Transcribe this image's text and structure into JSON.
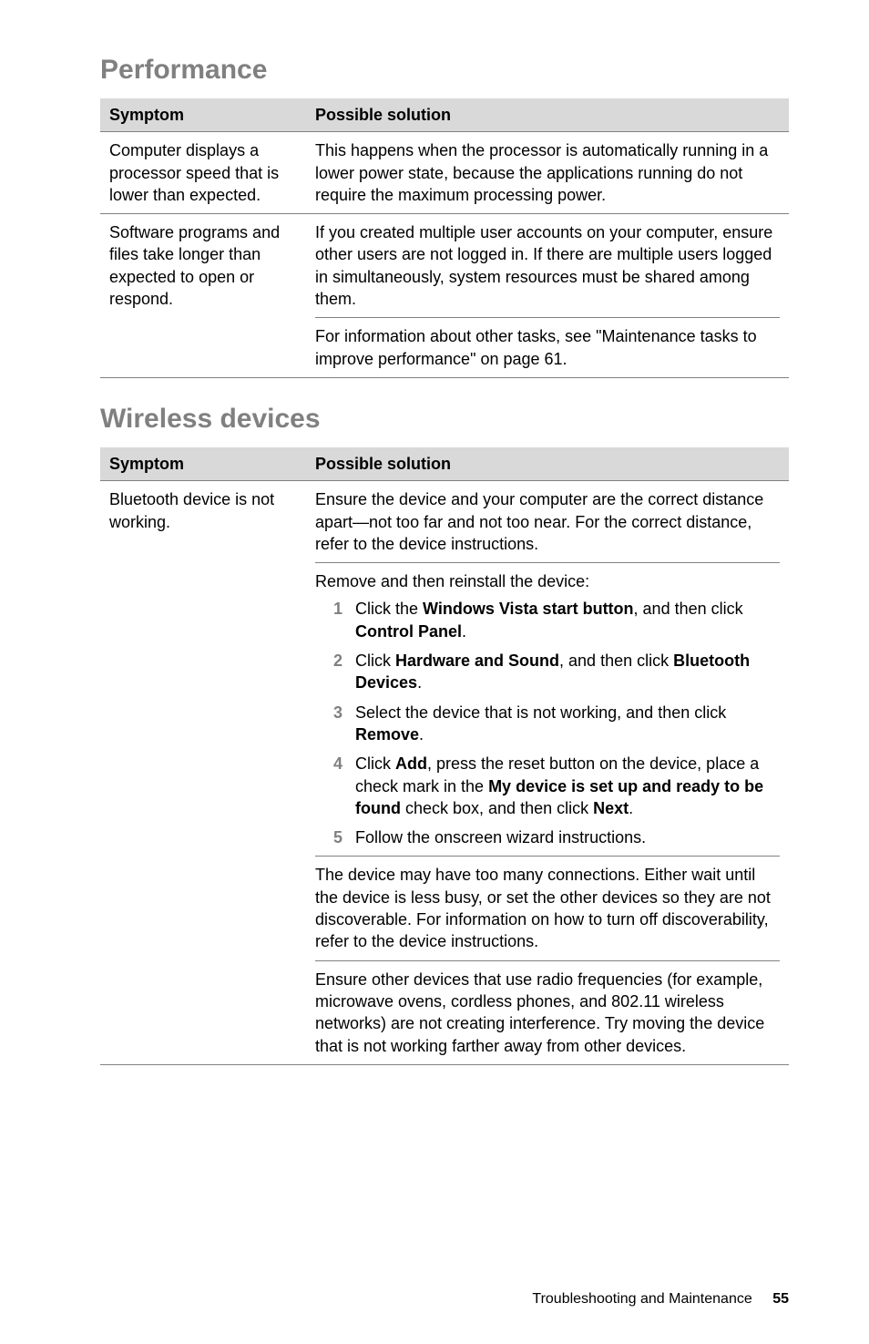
{
  "sections": [
    {
      "title": "Performance",
      "header_symptom": "Symptom",
      "header_solution": "Possible solution",
      "rows": [
        {
          "symptom": "Computer displays a processor speed that is lower than expected.",
          "blocks": [
            "This happens when the processor is automatically running in a lower power state, because the applications running do not require the maximum processing power."
          ]
        },
        {
          "symptom": "Software programs and files take longer than expected to open or respond.",
          "blocks": [
            "If you created multiple user accounts on your computer, ensure other users are not logged in. If there are multiple users logged in simultaneously, system resources must be shared among them.",
            "For information about other tasks, see \"Maintenance tasks to improve performance\" on page 61."
          ]
        }
      ]
    },
    {
      "title": "Wireless devices",
      "header_symptom": "Symptom",
      "header_solution": "Possible solution",
      "rows": [
        {
          "symptom": "Bluetooth device is not working.",
          "blocks": [
            "Ensure the device and your computer are the correct distance apart—not too far and not too near. For the correct distance, refer to the device instructions.",
            {
              "intro": "Remove and then reinstall the device:",
              "steps": [
                {
                  "num": "1",
                  "pre": "Click the ",
                  "b1": "Windows Vista start button",
                  "mid": ", and then click ",
                  "b2": "Control Panel",
                  "post": "."
                },
                {
                  "num": "2",
                  "pre": "Click ",
                  "b1": "Hardware and Sound",
                  "mid": ", and then click ",
                  "b2": "Bluetooth Devices",
                  "post": "."
                },
                {
                  "num": "3",
                  "pre": "Select the device that is not working, and then click ",
                  "b1": "Remove",
                  "mid": "",
                  "b2": "",
                  "post": "."
                },
                {
                  "num": "4",
                  "pre": "Click ",
                  "b1": "Add",
                  "mid": ", press the reset button on the device, place a check mark in the ",
                  "b2": "My device is set up and ready to be found",
                  "post2pre": " check box, and then click ",
                  "b3": "Next",
                  "post": "."
                },
                {
                  "num": "5",
                  "pre": "Follow the onscreen wizard instructions.",
                  "b1": "",
                  "mid": "",
                  "b2": "",
                  "post": ""
                }
              ]
            },
            "The device may have too many connections. Either wait until the device is less busy, or set the other devices so they are not discoverable. For information on how to turn off discoverability, refer to the device instructions.",
            "Ensure other devices that use radio frequencies (for example, microwave ovens, cordless phones, and 802.11 wireless networks) are not creating interference. Try moving the device that is not working farther away from other devices."
          ]
        }
      ]
    }
  ],
  "footer": {
    "label": "Troubleshooting and Maintenance",
    "page": "55"
  }
}
